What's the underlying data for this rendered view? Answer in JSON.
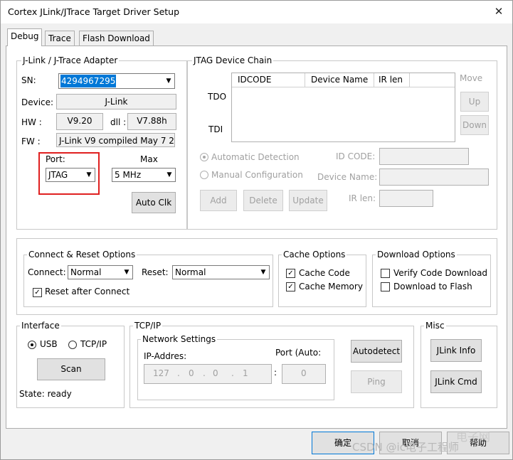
{
  "window": {
    "title": "Cortex JLink/JTrace Target Driver Setup",
    "close_icon": "close-icon"
  },
  "tabs": [
    {
      "label": "Debug"
    },
    {
      "label": "Trace"
    },
    {
      "label": "Flash Download"
    }
  ],
  "adapter": {
    "group_label": "J-Link / J-Trace Adapter",
    "sn_label": "SN:",
    "sn_value": "4294967295",
    "device_label": "Device:",
    "device_value": "J-Link",
    "hw_label": "HW :",
    "hw_value": "V9.20",
    "dll_label": "dll :",
    "dll_value": "V7.88h",
    "fw_label": "FW :",
    "fw_value": "J-Link V9 compiled May  7 2",
    "port_label": "Port:",
    "port_value": "JTAG",
    "max_label": "Max",
    "max_value": "5 MHz",
    "auto_clk": "Auto Clk"
  },
  "jtag": {
    "group_label": "JTAG Device Chain",
    "columns": [
      "IDCODE",
      "Device Name",
      "IR len"
    ],
    "tdo": "TDO",
    "tdi": "TDI",
    "move_label": "Move",
    "up": "Up",
    "down": "Down",
    "auto_detection": "Automatic Detection",
    "manual_config": "Manual Configuration",
    "id_code_label": "ID CODE:",
    "device_name_label": "Device Name:",
    "ir_len_label": "IR len:",
    "add": "Add",
    "delete": "Delete",
    "update": "Update"
  },
  "connect_reset": {
    "group_label": "Connect & Reset Options",
    "connect_label": "Connect:",
    "connect_value": "Normal",
    "reset_label": "Reset:",
    "reset_value": "Normal",
    "reset_after_connect": "Reset after Connect"
  },
  "cache": {
    "group_label": "Cache Options",
    "code": "Cache Code",
    "memory": "Cache Memory"
  },
  "download": {
    "group_label": "Download Options",
    "verify": "Verify Code Download",
    "to_flash": "Download to Flash"
  },
  "interface": {
    "group_label": "Interface",
    "usb": "USB",
    "tcpip": "TCP/IP",
    "scan": "Scan",
    "state": "State: ready"
  },
  "tcpip": {
    "group_label": "TCP/IP",
    "network_label": "Network Settings",
    "ip_label": "IP-Addres:",
    "port_label": "Port (Auto:",
    "ip_octets": [
      "127",
      "0",
      "0",
      "1"
    ],
    "port_value": "0",
    "autodetect": "Autodetect",
    "ping": "Ping"
  },
  "misc": {
    "group_label": "Misc",
    "jlink_info": "JLink Info",
    "jlink_cmd": "JLink Cmd"
  },
  "footer": {
    "ok": "确定",
    "cancel": "取消",
    "help": "帮助"
  },
  "watermark": {
    "csdn": "CSDN @ic电子工程师",
    "site": "电子网"
  }
}
